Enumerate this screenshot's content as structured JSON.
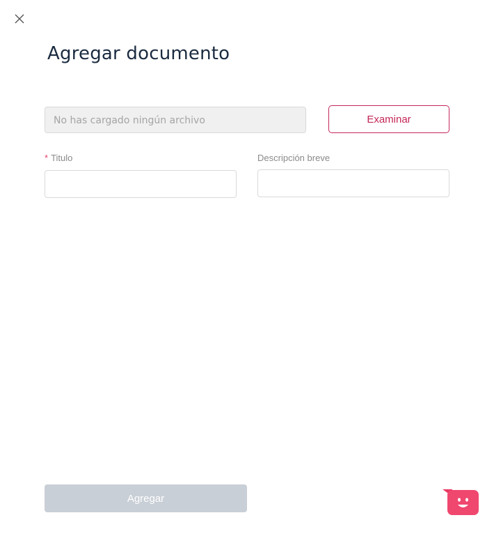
{
  "dialog": {
    "title": "Agregar documento",
    "close_icon": "close-icon"
  },
  "file_upload": {
    "placeholder": "No has cargado ningún archivo",
    "browse_label": "Examinar"
  },
  "form": {
    "title_required_mark": "*",
    "title_label": "Titulo",
    "title_value": "",
    "description_label": "Descripción breve",
    "description_value": ""
  },
  "footer": {
    "submit_label": "Agregar"
  },
  "chat_widget": {
    "icon": "chat-face-icon",
    "color": "#f0476f"
  },
  "colors": {
    "accent": "#c42758",
    "title": "#1b2b40",
    "disabled_button": "#c9cfd6",
    "required": "#e8416b"
  }
}
